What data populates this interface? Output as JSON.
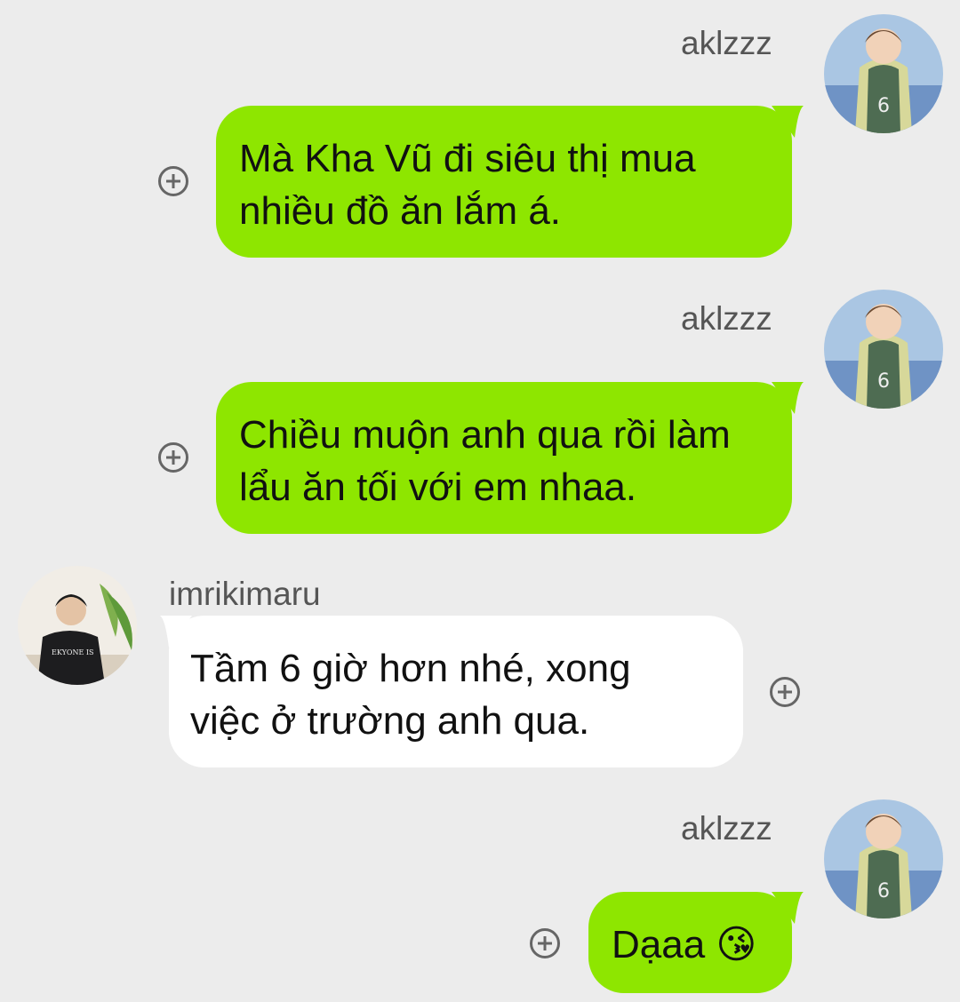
{
  "messages": [
    {
      "sender": "aklzzz",
      "lines": [
        "Mà Kha Vũ đi siêu thị mua",
        "nhiều đồ ăn lắm á."
      ]
    },
    {
      "sender": "aklzzz",
      "lines": [
        "Chiều muộn anh qua rồi làm",
        "lẩu ăn tối với em nhaa."
      ]
    },
    {
      "sender": "imrikimaru",
      "lines": [
        "Tầm 6 giờ hơn nhé, xong",
        "việc ở trường anh qua."
      ]
    },
    {
      "sender": "aklzzz",
      "text": "Dạaa",
      "emoji": "😘"
    }
  ],
  "icons": {
    "add": "plus-circle-icon",
    "avatar_me": "avatar-jersey-6",
    "avatar_other": "avatar-man-black-tshirt"
  },
  "colors": {
    "background": "#ececec",
    "outgoing_bubble": "#8ee600",
    "incoming_bubble": "#ffffff"
  }
}
